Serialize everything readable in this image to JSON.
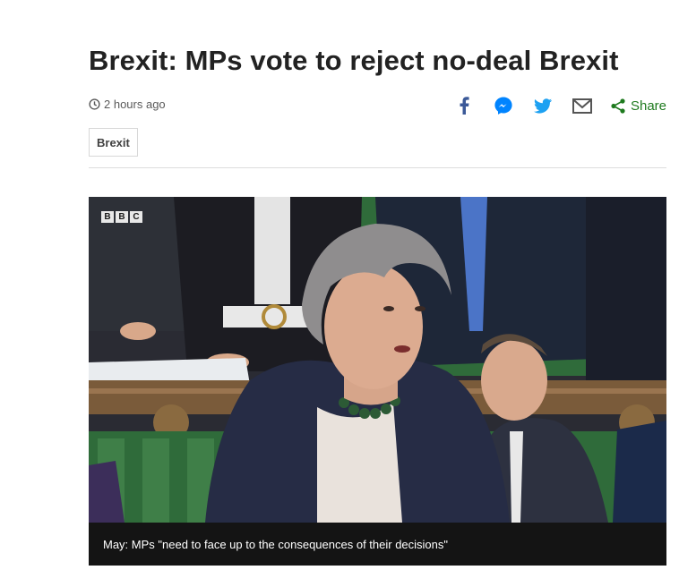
{
  "article": {
    "title": "Brexit: MPs vote to reject no-deal Brexit",
    "timestamp": "2 hours ago",
    "tag": "Brexit"
  },
  "share": {
    "icons": [
      "facebook-icon",
      "messenger-icon",
      "twitter-icon",
      "email-icon"
    ],
    "label": "Share"
  },
  "media": {
    "logo_letters": [
      "B",
      "B",
      "C"
    ],
    "caption": "May: MPs \"need to face up to the consequences of their decisions\""
  },
  "colors": {
    "facebook": "#3b5998",
    "messenger": "#0084ff",
    "twitter": "#1da1f2",
    "share_green": "#1e7a1e",
    "bench_green": "#2f6b3a"
  }
}
